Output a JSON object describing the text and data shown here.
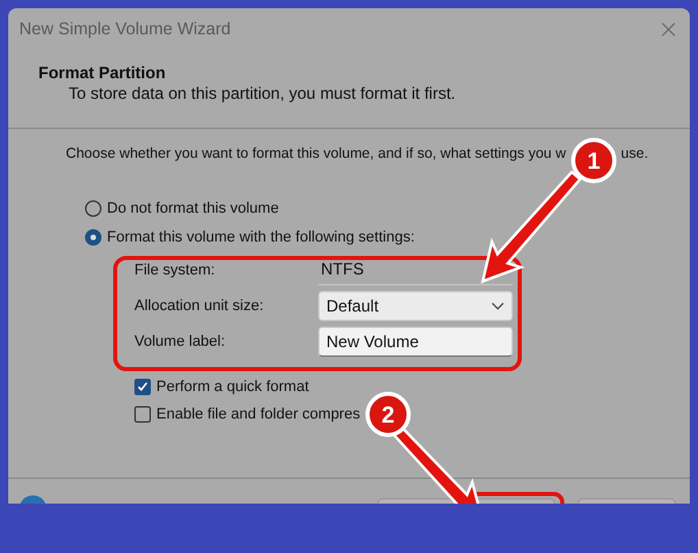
{
  "window": {
    "title": "New Simple Volume Wizard"
  },
  "header": {
    "title": "Format Partition",
    "subtitle": "To store data on this partition, you must format it first."
  },
  "instruction": {
    "text_before": "Choose whether you want to format this volume, and if so, what settings you w",
    "text_after": "use."
  },
  "options": [
    {
      "label": "Do not format this volume",
      "selected": false
    },
    {
      "label": "Format this volume with the following settings:",
      "selected": true
    }
  ],
  "settings": [
    {
      "kind": "text",
      "label": "File system:",
      "value": "NTFS"
    },
    {
      "kind": "dropdown",
      "label": "Allocation unit size:",
      "value": "Default"
    },
    {
      "kind": "input",
      "label": "Volume label:",
      "value": "New Volume"
    }
  ],
  "checkboxes": [
    {
      "label": "Perform a quick format",
      "checked": true
    },
    {
      "label": "Enable file and folder compres",
      "checked": false
    }
  ],
  "annotations": [
    {
      "number": "1"
    },
    {
      "number": "2"
    }
  ]
}
